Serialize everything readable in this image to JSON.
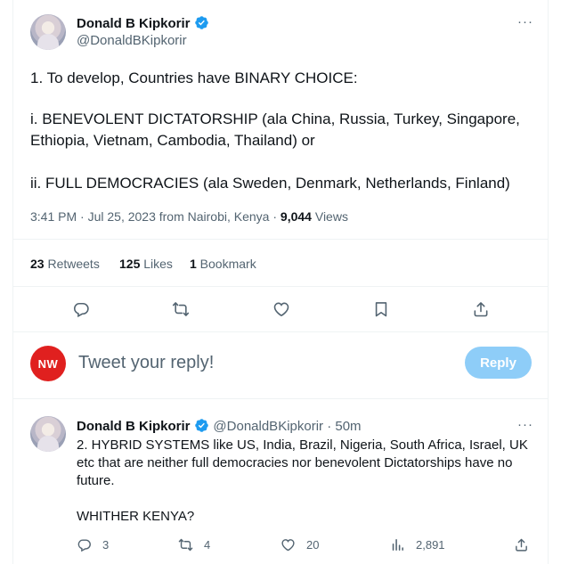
{
  "main_tweet": {
    "author_name": "Donald B Kipkorir",
    "author_handle": "@DonaldBKipkorir",
    "more_label": "···",
    "lines": [
      "1. To develop, Countries have BINARY CHOICE:",
      "i. BENEVOLENT DICTATORSHIP (ala China, Russia, Turkey, Singapore,",
      "Ethiopia, Vietnam, Cambodia, Thailand) or",
      "ii. FULL DEMOCRACIES (ala Sweden, Denmark, Netherlands, Finland)"
    ],
    "timestamp": "3:41 PM · Jul 25, 2023 from Nairobi, Kenya · ",
    "views_count": "9,044",
    "views_label": " Views",
    "stats": {
      "retweets_count": "23",
      "retweets_label": " Retweets",
      "likes_count": "125",
      "likes_label": " Likes",
      "bookmarks_count": "1",
      "bookmarks_label": " Bookmark"
    },
    "actions": [
      "reply-icon",
      "retweet-icon",
      "like-icon",
      "bookmark-icon",
      "share-icon"
    ]
  },
  "composer": {
    "avatar_text": "NW",
    "placeholder": "Tweet your reply!",
    "reply_button": "Reply",
    "reply_button_color": "#8ecdf8"
  },
  "reply_tweet": {
    "author_name": "Donald B Kipkorir",
    "author_handle": "@DonaldBKipkorir",
    "time": " · 50m",
    "more_label": "···",
    "lines": [
      "2. HYBRID SYSTEMS like US, India, Brazil, Nigeria, South Africa, Israel, UK",
      "etc that are neither full democracies nor benevolent Dictatorships have no",
      "future.",
      "WHITHER KENYA?"
    ],
    "actions": {
      "replies": "3",
      "retweets": "4",
      "likes": "20",
      "views": "2,891"
    }
  },
  "colors": {
    "accent": "#1d9bf0",
    "text": "#0f1419",
    "secondary": "#536471",
    "nw_badge": "#e0201f"
  }
}
